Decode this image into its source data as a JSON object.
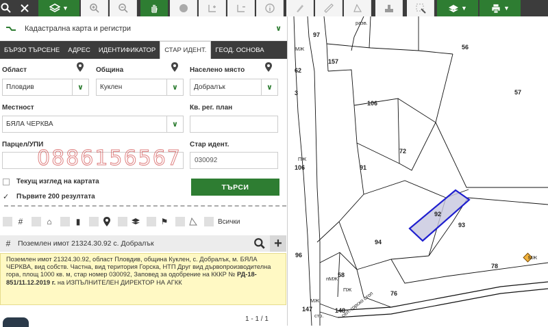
{
  "registry": {
    "title": "Кадастрална карта и регистри"
  },
  "tabs": [
    {
      "label": "БЪРЗО ТЪРСЕНЕ"
    },
    {
      "label": "АДРЕС"
    },
    {
      "label": "ИДЕНТИФИКАТОР"
    },
    {
      "label": "СТАР ИДЕНТ."
    },
    {
      "label": "ГЕОД. ОСНОВА"
    }
  ],
  "form": {
    "oblast_label": "Област",
    "oblast_value": "Пловдив",
    "obshtina_label": "Община",
    "obshtina_value": "Куклен",
    "naseleno_label": "Населено място",
    "naseleno_value": "Добралък",
    "mestnost_label": "Местност",
    "mestnost_value": "БЯЛА ЧЕРКВА",
    "kv_label": "Кв. рег. план",
    "kv_value": "",
    "parcel_label": "Парцел/УПИ",
    "parcel_value": "",
    "star_label": "Стар идент.",
    "star_value": "030092",
    "check_current": "Текущ изглед на картата",
    "check_first": "Първите 200 резултата",
    "search_button": "ТЪРСИ"
  },
  "watermark_phone": "0886156567",
  "filters": {
    "all_label": "Всички"
  },
  "result": {
    "header": "Поземлен имот 21324.30.92 с. Добралък",
    "body_text": "Поземлен имот 21324.30.92, област Пловдив, община Куклен, с. Добралък, м. БЯЛА ЧЕРКВА, вид собств. Частна, вид територия Горска, НТП Друг вид дървопроизводителна гора, площ 1000 кв. м, стар номер 030092,",
    "order_prefix": "Заповед за одобрение на КККР №",
    "order_number": "РД-18-851/11.12.2019 г.",
    "order_suffix": "на ИЗПЪЛНИТЕЛЕН ДИРЕКТОР НА АГКК"
  },
  "pager": "1 - 1 / 1",
  "map": {
    "labels": [
      "97",
      "разв.",
      "56",
      "МЖ",
      "157",
      "62",
      "57",
      "3",
      "106",
      "72",
      "91",
      "ПЖ",
      "106",
      "92",
      "93",
      "94",
      "96",
      "78",
      "МЖ",
      "58",
      "пМЖ",
      "ПЖ",
      "76",
      "МЖ",
      "147",
      "стр.",
      "148"
    ],
    "selected_parcel": "92",
    "road_label": "сел. горско стоп"
  },
  "colors": {
    "accent": "#2e7d32",
    "toolbar": "#3c3c3c",
    "highlight": "#1f1fcf",
    "result_bg": "#fff9c4"
  }
}
